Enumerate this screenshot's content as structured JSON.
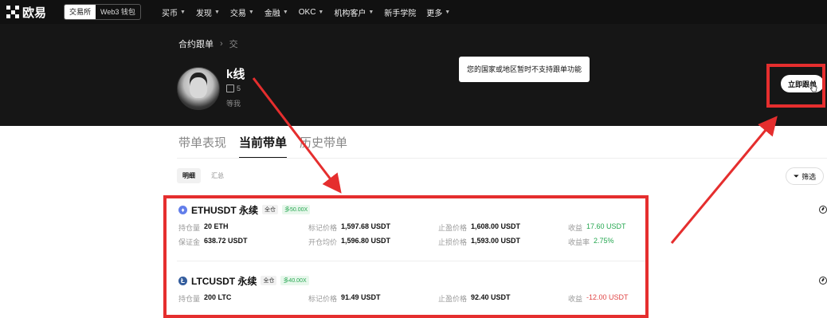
{
  "brand": {
    "name": "欧易"
  },
  "switcher": {
    "exchange": "交易所",
    "wallet": "Web3 钱包"
  },
  "nav": [
    {
      "label": "买币"
    },
    {
      "label": "发现"
    },
    {
      "label": "交易"
    },
    {
      "label": "金融"
    },
    {
      "label": "OKC"
    },
    {
      "label": "机构客户"
    },
    {
      "label": "新手学院"
    },
    {
      "label": "更多"
    }
  ],
  "breadcrumb": {
    "root": "合约跟单",
    "sep": "›",
    "current": "交"
  },
  "trader": {
    "name": "k线",
    "meta": "5",
    "sub": "等我"
  },
  "tooltip": "您的国家或地区暂时不支持跟单功能",
  "follow_button": "立即跟单",
  "tabs": [
    {
      "label": "带单表现"
    },
    {
      "label": "当前带单"
    },
    {
      "label": "历史带单"
    }
  ],
  "subtabs": [
    {
      "label": "明细"
    },
    {
      "label": "汇总"
    }
  ],
  "filter": {
    "label": "筛选"
  },
  "positions": [
    {
      "symbol": "ETHUSDT 永续",
      "icon_char": "♦",
      "icon_color": "#627eea",
      "mode": "全仓",
      "leverage": "多50.00X",
      "fields": [
        {
          "k": "持仓量",
          "v": "20 ETH"
        },
        {
          "k": "标记价格",
          "v": "1,597.68 USDT"
        },
        {
          "k": "止盈价格",
          "v": "1,608.00 USDT"
        },
        {
          "k": "收益",
          "v": "17.60 USDT",
          "tone": "up"
        },
        {
          "k": "保证金",
          "v": "638.72 USDT"
        },
        {
          "k": "开仓均价",
          "v": "1,596.80 USDT"
        },
        {
          "k": "止损价格",
          "v": "1,593.00 USDT"
        },
        {
          "k": "收益率",
          "v": "2.75%",
          "tone": "up"
        }
      ]
    },
    {
      "symbol": "LTCUSDT 永续",
      "icon_char": "Ł",
      "icon_color": "#345d9d",
      "mode": "全仓",
      "leverage": "多40.00X",
      "fields": [
        {
          "k": "持仓量",
          "v": "200 LTC"
        },
        {
          "k": "标记价格",
          "v": "91.49 USDT"
        },
        {
          "k": "止盈价格",
          "v": "92.40 USDT"
        },
        {
          "k": "收益",
          "v": "-12.00 USDT",
          "tone": "down"
        }
      ]
    }
  ],
  "colors": {
    "annotation_red": "#e52e2e",
    "up": "#25a750",
    "down": "#e04545"
  }
}
